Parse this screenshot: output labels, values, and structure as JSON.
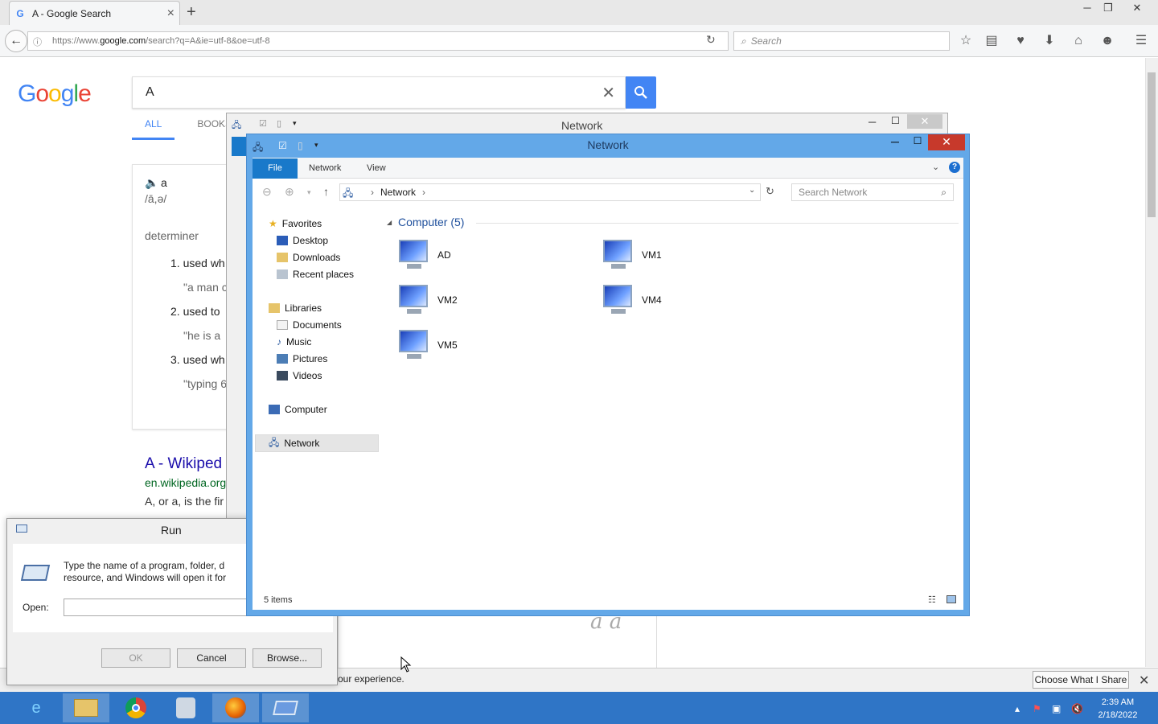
{
  "browser": {
    "tab_title": "A - Google Search",
    "tab_close": "×",
    "new_tab": "+",
    "url_prefix": "https://www.",
    "url_domain": "google.com",
    "url_path": "/search?q=A&ie=utf-8&oe=utf-8",
    "search_placeholder": "Search",
    "win_min": "─",
    "win_restore": "❐",
    "win_close": "✕"
  },
  "google": {
    "query": "A",
    "clear": "✕",
    "tab_all": "ALL",
    "tab_books": "BOOKS",
    "dict_word": "a",
    "dict_pron": "/ā,ə/",
    "dict_pos": "determiner",
    "def1": "1. used wh",
    "ex1": "\"a man c",
    "def2": "2. used to",
    "ex2": "\"he is a",
    "def3": "3. used wh",
    "ex3": "\"typing 6",
    "wiki_title": "A - Wikiped",
    "wiki_url": "en.wikipedia.org",
    "wiki_snip": "A, or a, is the fir"
  },
  "notification": {
    "text": "our experience.",
    "share_button": "Choose What I Share"
  },
  "explorer_back": {
    "title": "Network"
  },
  "explorer": {
    "title": "Network",
    "ribbon_tabs": [
      "File",
      "Network",
      "View"
    ],
    "breadcrumb": "Network",
    "search_placeholder": "Search Network",
    "nav": {
      "favorites": "Favorites",
      "desktop": "Desktop",
      "downloads": "Downloads",
      "recent": "Recent places",
      "libraries": "Libraries",
      "documents": "Documents",
      "music": "Music",
      "pictures": "Pictures",
      "videos": "Videos",
      "computer": "Computer",
      "network": "Network"
    },
    "group_header": "Computer (5)",
    "computers": [
      "AD",
      "VM1",
      "VM2",
      "VM4",
      "VM5"
    ],
    "status": "5 items"
  },
  "run": {
    "title": "Run",
    "description": "Type the name of a program, folder, d resource, and Windows will open it for",
    "open_label": "Open:",
    "ok": "OK",
    "cancel": "Cancel",
    "browse": "Browse..."
  },
  "taskbar": {
    "time": "2:39 AM",
    "date": "2/18/2022"
  }
}
